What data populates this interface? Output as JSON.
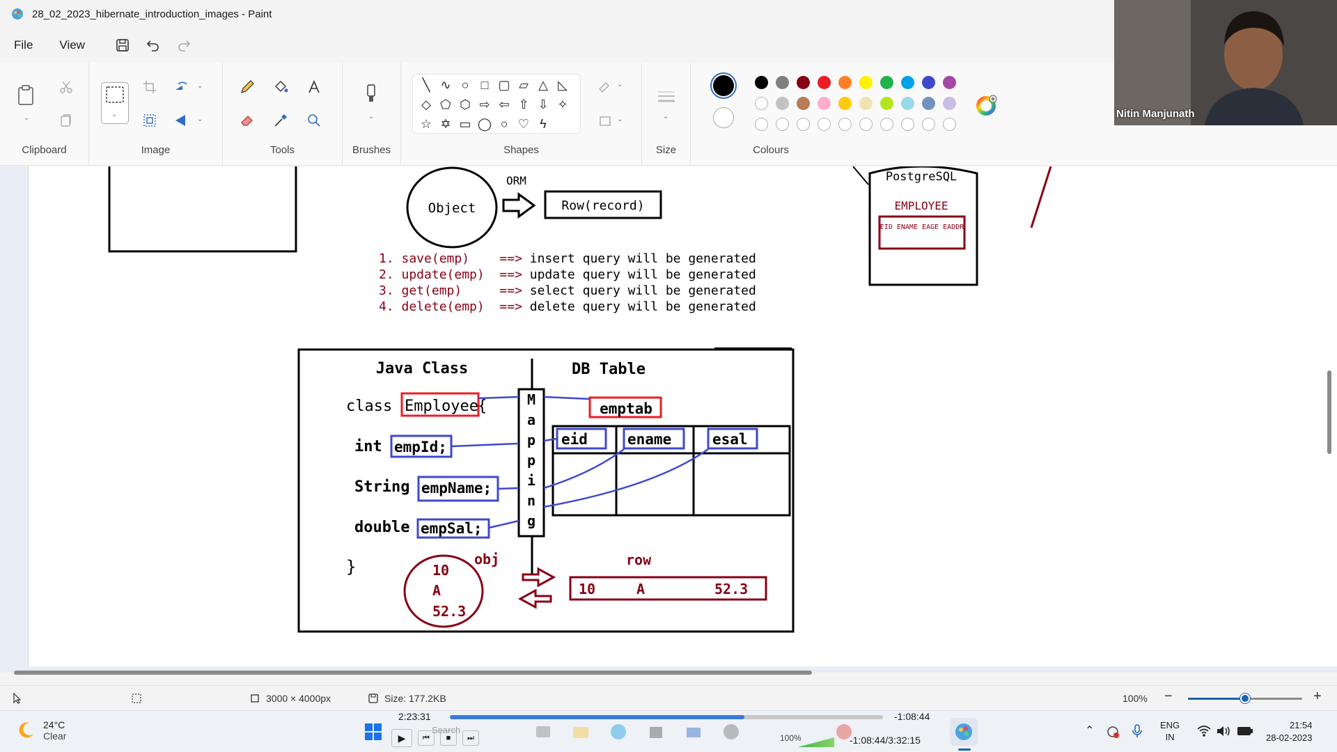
{
  "window": {
    "title": "28_02_2023_hibernate_introduction_images - Paint"
  },
  "menu": {
    "file": "File",
    "view": "View"
  },
  "ribbon": {
    "groups": {
      "clipboard": "Clipboard",
      "image": "Image",
      "tools": "Tools",
      "brushes": "Brushes",
      "shapes": "Shapes",
      "size": "Size",
      "colours": "Colours"
    },
    "colours_row1": [
      "#000000",
      "#7f7f7f",
      "#880015",
      "#ed1c24",
      "#ff7f27",
      "#fff200",
      "#22b14c",
      "#00a2e8",
      "#3f48cc",
      "#a349a4"
    ],
    "colours_row2": [
      "#ffffff",
      "#c3c3c3",
      "#b97a57",
      "#ffaec9",
      "#ffc90e",
      "#efe4b0",
      "#b5e61d",
      "#99d9ea",
      "#7092be",
      "#c8bfe7"
    ],
    "primary_colour": "#000000",
    "secondary_colour": "#ffffff"
  },
  "webcam": {
    "name": "Nitin Manjunath"
  },
  "drawing": {
    "orm_label": "ORM",
    "object_label": "Object",
    "row_record": "Row(record)",
    "postgres_label": "PostgreSQL",
    "employee_table": "EMPLOYEE",
    "employee_cols": "EID ENAME EAGE EADDR",
    "operations": [
      {
        "num": "1.",
        "call": "save(emp)",
        "pad": "   ",
        "arrow": "==>",
        "desc": "insert query will be generated"
      },
      {
        "num": "2.",
        "call": "update(emp)",
        "pad": " ",
        "arrow": "==>",
        "desc": "update query will be generated"
      },
      {
        "num": "3.",
        "call": "get(emp)",
        "pad": "    ",
        "arrow": "==>",
        "desc": "select query will be generated"
      },
      {
        "num": "4.",
        "call": "delete(emp)",
        "pad": " ",
        "arrow": "==>",
        "desc": "delete query will be generated"
      }
    ],
    "java_class_heading": "Java Class",
    "db_table_heading": "DB Table",
    "class_kw": "class",
    "class_name": "Employee",
    "brace_open": "{",
    "brace_close": "}",
    "fields": [
      {
        "type": "int",
        "name": "empId;"
      },
      {
        "type": "String",
        "name": "empName;"
      },
      {
        "type": "double",
        "name": "empSal;"
      }
    ],
    "mapping_letters": [
      "M",
      "a",
      "p",
      "p",
      "i",
      "n",
      "g"
    ],
    "table_name": "emptab",
    "columns": [
      "eid",
      "ename",
      "esal"
    ],
    "obj_label": "obj",
    "obj_values": [
      "10",
      "A",
      "52.3"
    ],
    "row_label": "row",
    "row_values": [
      "10",
      "A",
      "52.3"
    ]
  },
  "status": {
    "dimensions": "3000 × 4000px",
    "size": "Size: 177.2KB",
    "zoom": "100%",
    "zoom_level": 0.5
  },
  "player": {
    "elapsed": "2:23:31",
    "remaining": "-1:08:44",
    "position": "-1:08:44/3:32:15",
    "volume": "100%",
    "progress": 0.68,
    "search_hint": "Search"
  },
  "taskbar": {
    "temperature": "24°C",
    "weather": "Clear",
    "language": "ENG",
    "region": "IN",
    "time": "21:54",
    "date": "28-02-2023"
  }
}
